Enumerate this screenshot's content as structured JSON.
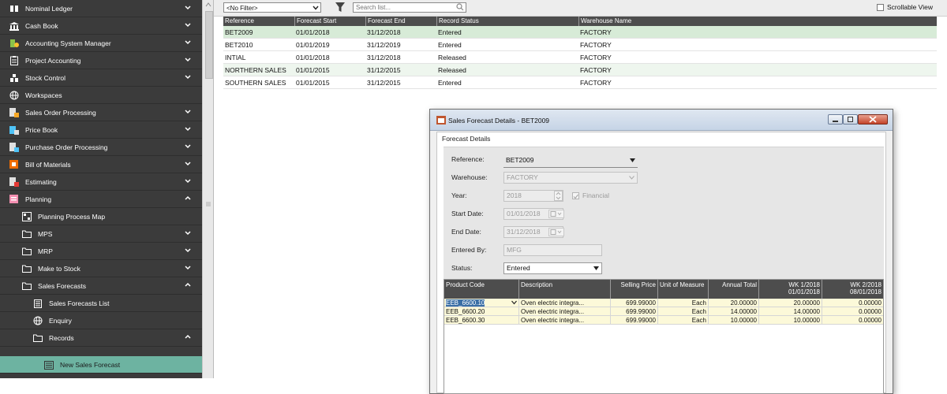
{
  "sidebar": {
    "items": [
      {
        "label": "Nominal Ledger",
        "icon": "ledger-icon",
        "chevron": "down",
        "indent": 0
      },
      {
        "label": "Cash Book",
        "icon": "bank-icon",
        "chevron": "down",
        "indent": 0
      },
      {
        "label": "Accounting System Manager",
        "icon": "gear-chart-icon",
        "chevron": "down",
        "indent": 0
      },
      {
        "label": "Project Accounting",
        "icon": "clipboard-icon",
        "chevron": "down",
        "indent": 0
      },
      {
        "label": "Stock Control",
        "icon": "stock-icon",
        "chevron": "down",
        "indent": 0
      },
      {
        "label": "Workspaces",
        "icon": "globe-icon",
        "chevron": "",
        "indent": 0
      },
      {
        "label": "Sales Order Processing",
        "icon": "sales-order-icon",
        "chevron": "down",
        "indent": 0
      },
      {
        "label": "Price Book",
        "icon": "price-book-icon",
        "chevron": "down",
        "indent": 0
      },
      {
        "label": "Purchase Order Processing",
        "icon": "purchase-order-icon",
        "chevron": "down",
        "indent": 0
      },
      {
        "label": "Bill of Materials",
        "icon": "bom-icon",
        "chevron": "down",
        "indent": 0
      },
      {
        "label": "Estimating",
        "icon": "estimating-icon",
        "chevron": "down",
        "indent": 0
      },
      {
        "label": "Planning",
        "icon": "planning-icon",
        "chevron": "up",
        "indent": 0
      },
      {
        "label": "Planning Process Map",
        "icon": "process-map-icon",
        "chevron": "",
        "indent": 1
      },
      {
        "label": "MPS",
        "icon": "folder-icon",
        "chevron": "down",
        "indent": 1
      },
      {
        "label": "MRP",
        "icon": "folder-icon",
        "chevron": "down",
        "indent": 1
      },
      {
        "label": "Make to Stock",
        "icon": "folder-icon",
        "chevron": "down",
        "indent": 1
      },
      {
        "label": "Sales Forecasts",
        "icon": "folder-icon",
        "chevron": "up",
        "indent": 1
      },
      {
        "label": "Sales Forecasts List",
        "icon": "list-icon",
        "chevron": "",
        "indent": 2
      },
      {
        "label": "Enquiry",
        "icon": "globe-icon",
        "chevron": "",
        "indent": 2
      },
      {
        "label": "Records",
        "icon": "folder-icon",
        "chevron": "up",
        "indent": 2
      },
      {
        "label": "New Sales Forecast",
        "icon": "form-icon",
        "chevron": "",
        "indent": 3,
        "active": true
      }
    ]
  },
  "toolbar": {
    "filter_value": "<No Filter>",
    "search_placeholder": "Search list...",
    "scrollable_view_label": "Scrollable View"
  },
  "list": {
    "columns": [
      "Reference",
      "Forecast Start",
      "Forecast End",
      "Record Status",
      "Warehouse Name"
    ],
    "rows": [
      {
        "reference": "BET2009",
        "start": "01/01/2018",
        "end": "31/12/2018",
        "status": "Entered",
        "warehouse": "FACTORY"
      },
      {
        "reference": "BET2010",
        "start": "01/01/2019",
        "end": "31/12/2019",
        "status": "Entered",
        "warehouse": "FACTORY"
      },
      {
        "reference": "INTIAL",
        "start": "01/01/2018",
        "end": "31/12/2018",
        "status": "Released",
        "warehouse": "FACTORY"
      },
      {
        "reference": "NORTHERN SALES",
        "start": "01/01/2015",
        "end": "31/12/2015",
        "status": "Released",
        "warehouse": "FACTORY"
      },
      {
        "reference": "SOUTHERN SALES",
        "start": "01/01/2015",
        "end": "31/12/2015",
        "status": "Entered",
        "warehouse": "FACTORY"
      }
    ]
  },
  "dialog": {
    "title": "Sales Forecast Details - BET2009",
    "group_title": "Forecast Details",
    "fields": {
      "reference": {
        "label": "Reference:",
        "value": "BET2009"
      },
      "warehouse": {
        "label": "Warehouse:",
        "value": "FACTORY"
      },
      "year": {
        "label": "Year:",
        "value": "2018",
        "financial_label": "Financial"
      },
      "start_date": {
        "label": "Start Date:",
        "value": "01/01/2018"
      },
      "end_date": {
        "label": "End Date:",
        "value": "31/12/2018"
      },
      "entered_by": {
        "label": "Entered By:",
        "value": "MFG"
      },
      "status": {
        "label": "Status:",
        "value": "Entered"
      }
    },
    "grid": {
      "columns": [
        "Product Code",
        "Description",
        "Selling Price",
        "Unit of Measure",
        "Annual Total",
        "WK 1/2018",
        "WK 2/2018"
      ],
      "column_sub": {
        "wk1": "01/01/2018",
        "wk2": "08/01/2018"
      },
      "rows": [
        {
          "code": "EEB_6600.10",
          "desc": "Oven electric integra...",
          "price": "699.99000",
          "uom": "Each",
          "annual": "20.00000",
          "wk1": "20.00000",
          "wk2": "0.00000"
        },
        {
          "code": "EEB_6600.20",
          "desc": "Oven electric integra...",
          "price": "699.99000",
          "uom": "Each",
          "annual": "14.00000",
          "wk1": "14.00000",
          "wk2": "0.00000"
        },
        {
          "code": "EEB_6600.30",
          "desc": "Oven electric integra...",
          "price": "699.99000",
          "uom": "Each",
          "annual": "10.00000",
          "wk1": "10.00000",
          "wk2": "0.00000"
        }
      ]
    }
  },
  "colors": {
    "sidebar_bg": "#3b3b3b",
    "active_item": "#6db3a1",
    "header_bg": "#4d4d4d",
    "grid_row": "#fcf9d9",
    "close_button": "#c4442a"
  }
}
